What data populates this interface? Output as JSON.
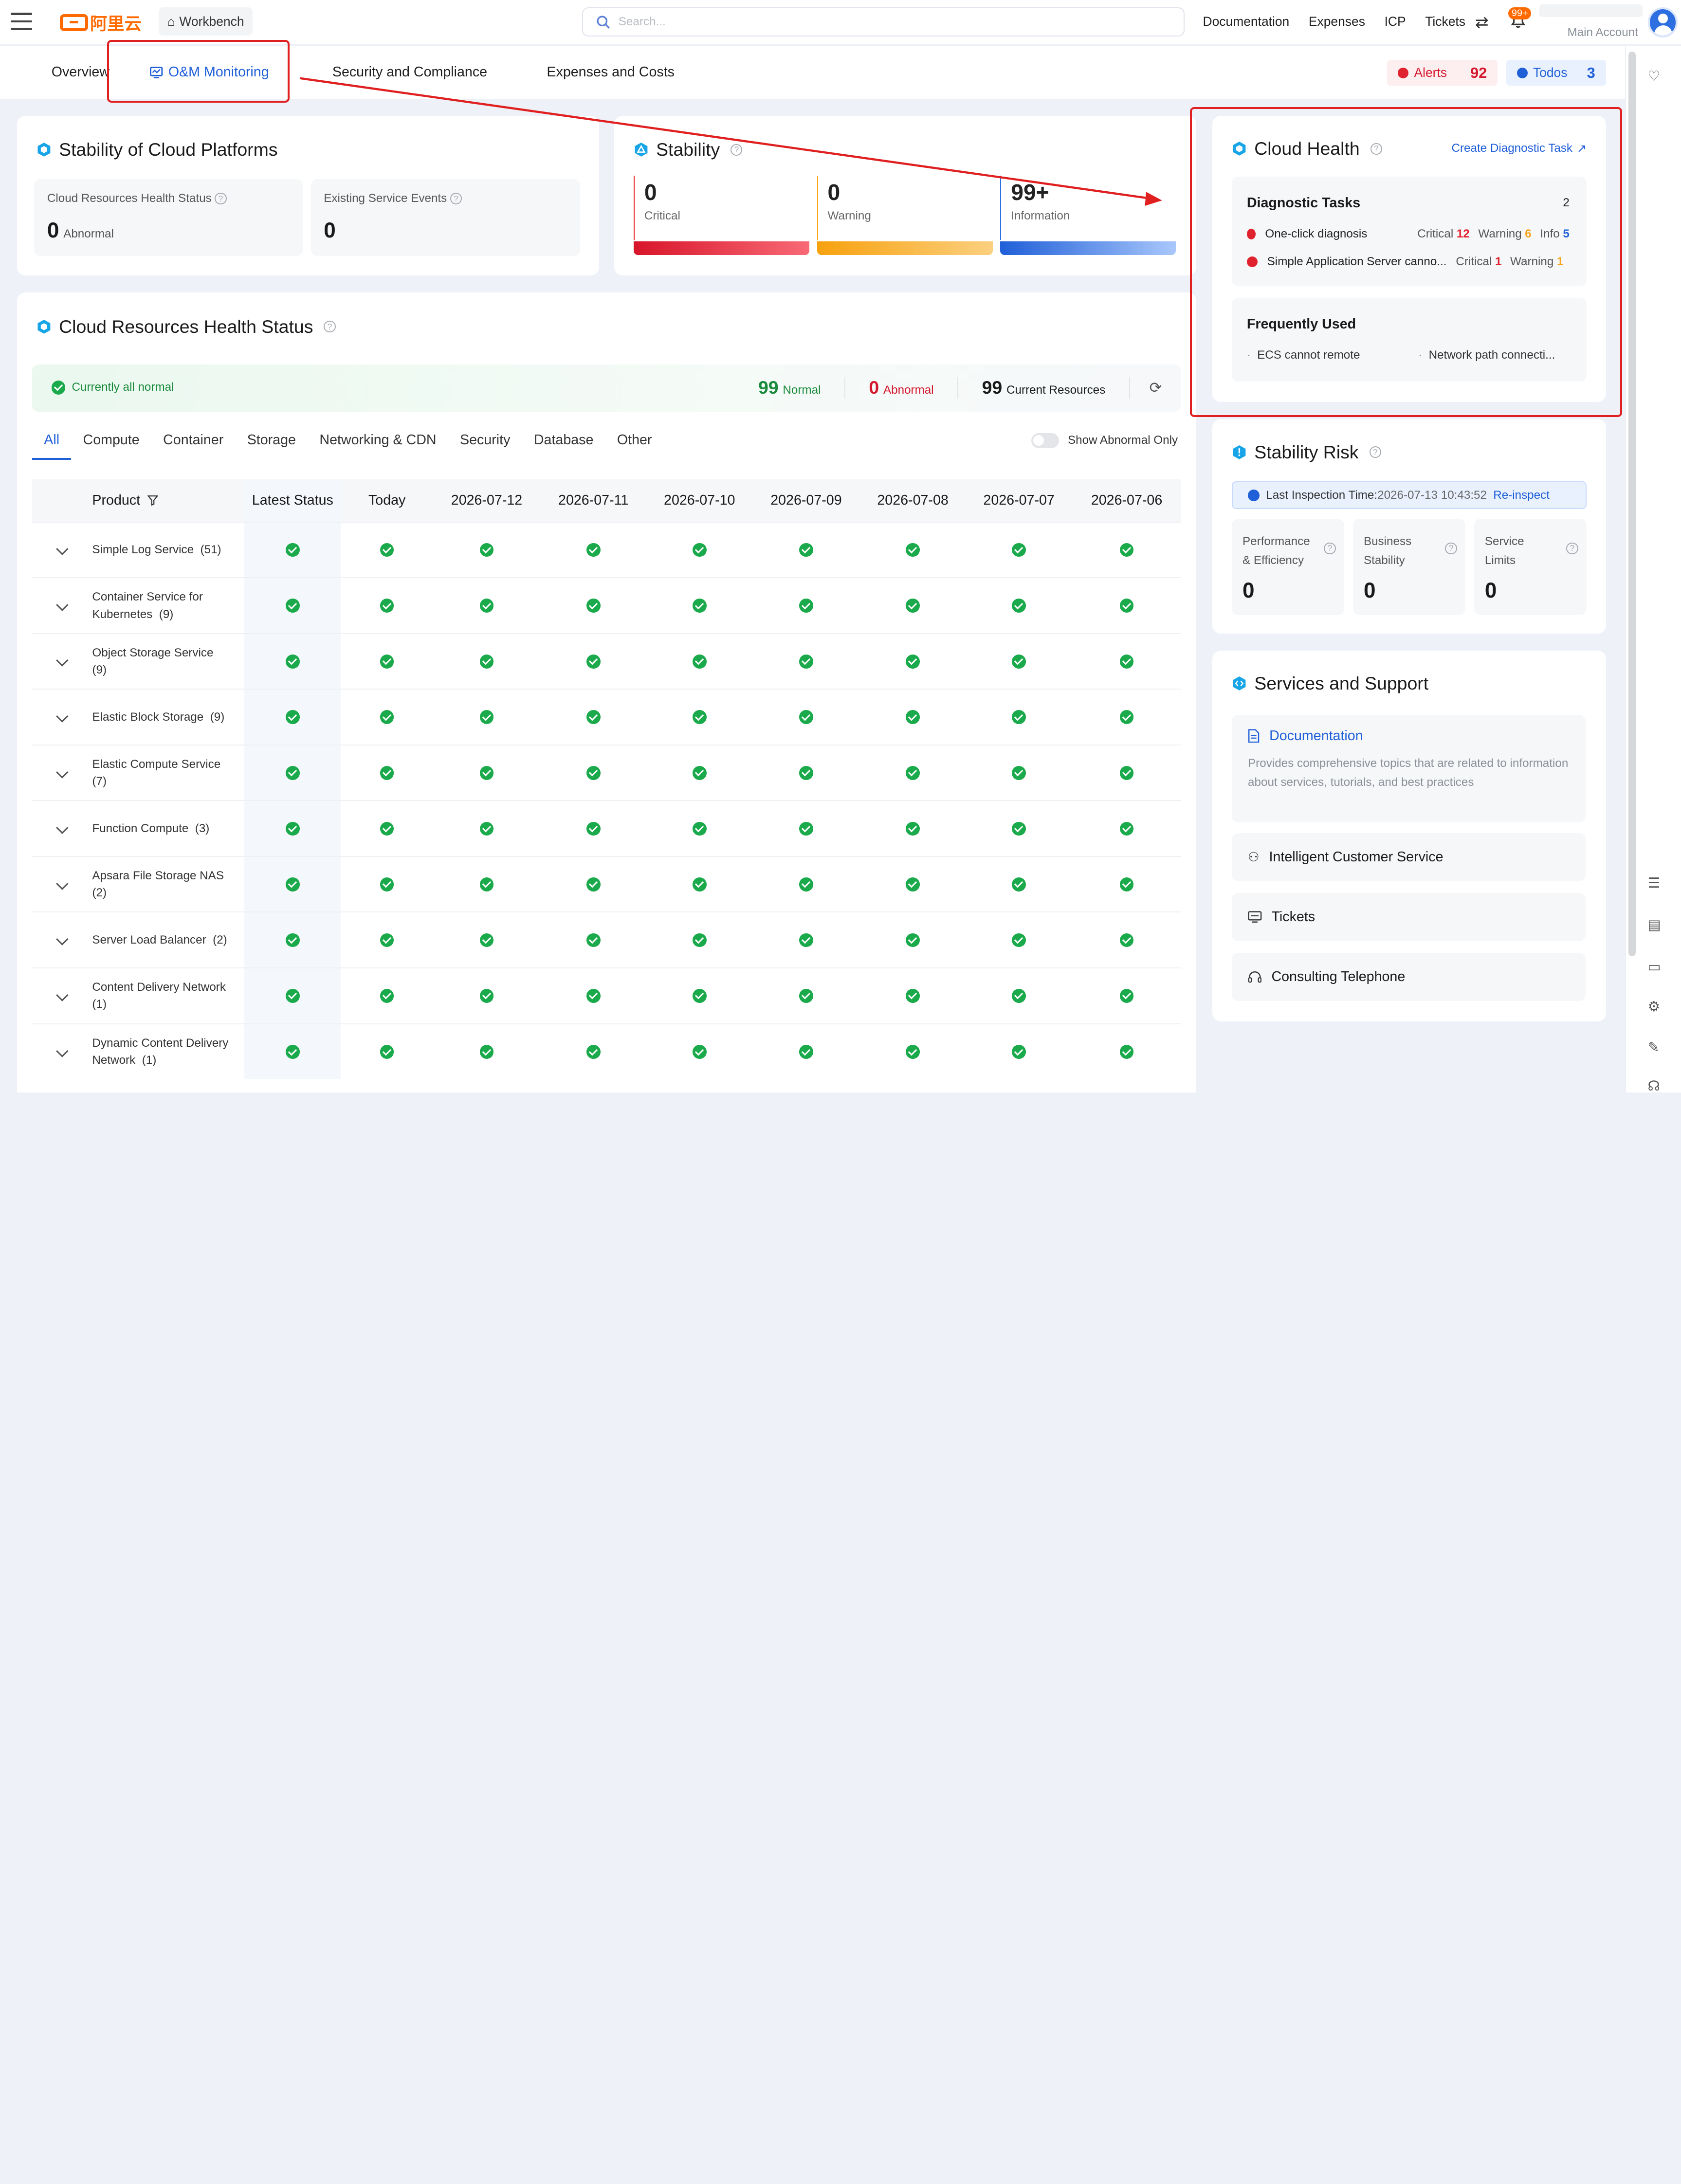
{
  "topbar": {
    "logo_text": "阿里云",
    "workbench": "Workbench",
    "search_placeholder": "Search...",
    "links": [
      "Documentation",
      "Expenses",
      "ICP",
      "Tickets"
    ],
    "notification_badge": "99+",
    "account_label": "Main Account"
  },
  "tabs": {
    "overview": "Overview",
    "om_monitoring": "O&M Monitoring",
    "security": "Security and Compliance",
    "expenses": "Expenses and Costs",
    "alerts_label": "Alerts",
    "alerts_count": "92",
    "todos_label": "Todos",
    "todos_count": "3"
  },
  "stability_platforms": {
    "title": "Stability of Cloud Platforms",
    "health_label": "Cloud Resources Health Status",
    "health_value": "0",
    "health_unit": "Abnormal",
    "events_label": "Existing Service Events",
    "events_value": "0"
  },
  "stability": {
    "title": "Stability",
    "items": [
      {
        "value": "0",
        "label": "Critical",
        "color": "#e0222f"
      },
      {
        "value": "0",
        "label": "Warning",
        "color": "#f8a41a"
      },
      {
        "value": "99+",
        "label": "Information",
        "color": "#2a6ee8"
      }
    ]
  },
  "resources": {
    "title": "Cloud Resources Health Status",
    "banner_text": "Currently all normal",
    "normal_count": "99",
    "normal_label": "Normal",
    "abnormal_count": "0",
    "abnormal_label": "Abnormal",
    "current_count": "99",
    "current_label": "Current Resources",
    "categories": [
      "All",
      "Compute",
      "Container",
      "Storage",
      "Networking & CDN",
      "Security",
      "Database",
      "Other"
    ],
    "show_abnormal_label": "Show Abnormal Only",
    "columns": {
      "product": "Product",
      "latest": "Latest Status",
      "today": "Today",
      "dates": [
        "2026-07-12",
        "2026-07-11",
        "2026-07-10",
        "2026-07-09",
        "2026-07-08",
        "2026-07-07",
        "2026-07-06"
      ]
    },
    "rows": [
      {
        "name": "Simple Log Service",
        "count": "(51)"
      },
      {
        "name": "Container Service for Kubernetes",
        "count": "(9)"
      },
      {
        "name": "Object Storage Service",
        "count": "(9)"
      },
      {
        "name": "Elastic Block Storage",
        "count": "(9)"
      },
      {
        "name": "Elastic Compute Service",
        "count": "(7)"
      },
      {
        "name": "Function Compute",
        "count": "(3)"
      },
      {
        "name": "Apsara File Storage NAS",
        "count": "(2)"
      },
      {
        "name": "Server Load Balancer",
        "count": "(2)"
      },
      {
        "name": "Content Delivery Network",
        "count": "(1)"
      },
      {
        "name": "Dynamic Content Delivery Network",
        "count": "(1)"
      }
    ]
  },
  "cloud_health": {
    "title": "Cloud Health",
    "create_task": "Create Diagnostic Task",
    "diag_title": "Diagnostic Tasks",
    "diag_count": "2",
    "diag_rows": [
      {
        "name": "One-click diagnosis",
        "critical_label": "Critical",
        "critical": "12",
        "warning_label": "Warning",
        "warning": "6",
        "info_label": "Info",
        "info": "5"
      },
      {
        "name": "Simple Application Server canno...",
        "critical_label": "Critical",
        "critical": "1",
        "warning_label": "Warning",
        "warning": "1"
      }
    ],
    "freq_title": "Frequently Used",
    "freq_items": [
      "ECS cannot remote",
      "Network path connecti..."
    ]
  },
  "stability_risk": {
    "title": "Stability Risk",
    "inspection_label": "Last Inspection Time:",
    "inspection_time": "2026-07-13 10:43:52",
    "reinspect": "Re-inspect",
    "metrics": [
      {
        "label1": "Performance",
        "label2": "& Efficiency",
        "value": "0"
      },
      {
        "label1": "Business",
        "label2": "Stability",
        "value": "0"
      },
      {
        "label1": "Service",
        "label2": "Limits",
        "value": "0"
      }
    ]
  },
  "services": {
    "title": "Services and Support",
    "doc_title": "Documentation",
    "doc_desc": "Provides comprehensive topics that are related to information about services, tutorials, and best practices",
    "items": [
      "Intelligent Customer Service",
      "Tickets",
      "Consulting Telephone"
    ]
  },
  "colors": {
    "accent_blue": "#1f5fd8",
    "critical_red": "#e0222f",
    "warning_orange": "#f8a41a",
    "ok_green": "#1aaa4b",
    "annotation_red": "#e02020"
  }
}
